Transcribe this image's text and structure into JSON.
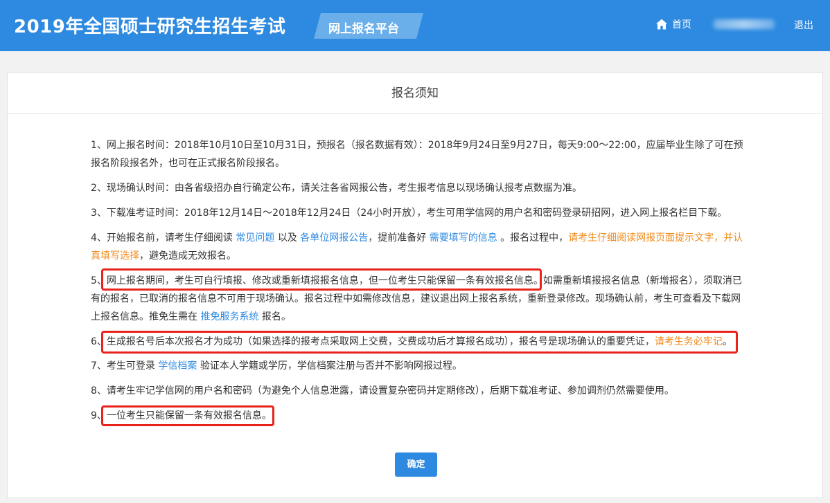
{
  "header": {
    "app_title": "2019年全国硕士研究生招生考试",
    "platform_tag": "网上报名平台",
    "home_label": "首页",
    "logout_label": "退出"
  },
  "card": {
    "title": "报名须知",
    "items": [
      {
        "prefix": "1、",
        "text": "网上报名时间：2018年10月10日至10月31日，预报名（报名数据有效）：2018年9月24日至9月27日，每天9:00～22:00，应届毕业生除了可在预报名阶段报名外，也可在正式报名阶段报名。"
      },
      {
        "prefix": "2、",
        "text": "现场确认时间：由各省级招办自行确定公布，请关注各省网报公告，考生报考信息以现场确认报考点数据为准。"
      },
      {
        "prefix": "3、",
        "text": "下载准考证时间：2018年12月14日～2018年12月24日（24小时开放），考生可用学信网的用户名和密码登录研招网，进入网上报名栏目下载。"
      },
      {
        "prefix": "4、",
        "t1": "开始报名前，请考生仔细阅读 ",
        "link1": "常见问题",
        "t2": " 以及 ",
        "link2": "各单位网报公告",
        "t3": "，提前准备好 ",
        "link3": "需要填写的信息",
        "t4": " 。报名过程中，",
        "warn": "请考生仔细阅读网报页面提示文字，并认真填写选择",
        "t5": "，避免造成无效报名。"
      },
      {
        "prefix": "5、",
        "t1": "网上报名期间，考生可自行填报、修改或重新填报报名信息，但一位考生只能保留一条有效报名信息。如需重新填报报名信息（新增报名），须取消已有的报名，已取消的报名信息不可用于现场确认。报名过程中如需修改信息，建议退出网上报名系统，重新登录修改。现场确认前，考生可查看及下载网上报名信息。推免生需在 ",
        "link1": "推免服务系统",
        "t2": " 报名。"
      },
      {
        "prefix": "6、",
        "t1": "生成报名号后本次报名才为成功（如果选择的报考点采取网上交费，交费成功后才算报名成功），报名号是现场确认的重要凭证，",
        "warn": "请考生务必牢记",
        "t2": "。"
      },
      {
        "prefix": "7、",
        "t1": "考生可登录 ",
        "link1": "学信档案",
        "t2": " 验证本人学籍或学历，学信档案注册与否并不影响网报过程。"
      },
      {
        "prefix": "8、",
        "text": "请考生牢记学信网的用户名和密码（为避免个人信息泄露，请设置复杂密码并定期修改），后期下载准考证、参加调剂仍然需要使用。"
      },
      {
        "prefix": "9、",
        "text": "一位考生只能保留一条有效报名信息。"
      }
    ],
    "confirm_label": "确定"
  },
  "colors": {
    "header_bg": "#2d8ae0",
    "link": "#2d8ae0",
    "warning": "#f08a1c",
    "highlight_box": "#e8231b"
  },
  "icons": [
    "home-icon"
  ]
}
